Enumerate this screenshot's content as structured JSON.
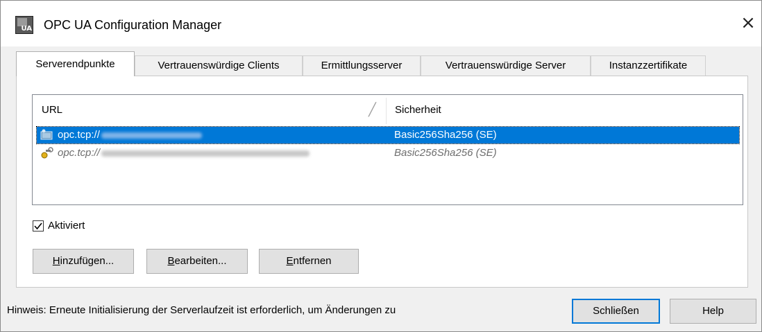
{
  "window": {
    "title": "OPC UA Configuration Manager",
    "close_glyph": "×",
    "app_icon": "opc-ua-app-icon",
    "app_icon_text": "UA"
  },
  "tabs": [
    {
      "label": "Serverendpunkte",
      "active": true
    },
    {
      "label": "Vertrauenswürdige Clients",
      "active": false
    },
    {
      "label": "Ermittlungsserver",
      "active": false
    },
    {
      "label": "Vertrauenswürdige Server",
      "active": false
    },
    {
      "label": "Instanzzertifikate",
      "active": false
    }
  ],
  "endpoints": {
    "columns": {
      "url": "URL",
      "security": "Sicherheit",
      "sort_glyph": "╱"
    },
    "rows": [
      {
        "url_prefix": "opc.tcp://",
        "url_rest_obscured": true,
        "security": "Basic256Sha256 (SE)",
        "state": "selected",
        "icon": "endpoint-enabled-icon"
      },
      {
        "url_prefix": "opc.tcp://",
        "url_rest_obscured": true,
        "security": "Basic256Sha256 (SE)",
        "state": "disabled",
        "icon": "endpoint-disabled-icon"
      }
    ]
  },
  "enabled_checkbox": {
    "label": "Aktiviert",
    "checked": true
  },
  "buttons": {
    "add": {
      "accel": "H",
      "rest": "inzufügen..."
    },
    "edit": {
      "accel": "B",
      "rest": "earbeiten..."
    },
    "remove": {
      "accel": "E",
      "rest": "ntfernen"
    }
  },
  "footer": {
    "hint": "Hinweis: Erneute Initialisierung der Serverlaufzeit ist erforderlich, um Änderungen zu",
    "close_label": "Schließen",
    "help_label": "Help"
  },
  "colors": {
    "selection": "#0078d7",
    "default_button_border": "#0078d7"
  }
}
